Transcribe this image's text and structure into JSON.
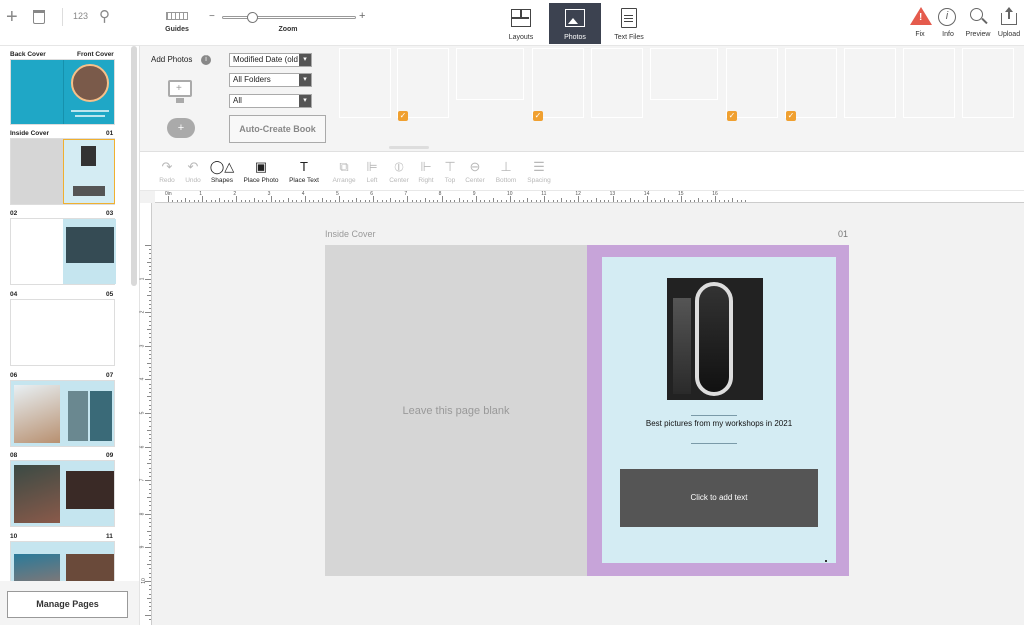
{
  "topbar": {
    "counter": "123",
    "guides_label": "Guides",
    "zoom_label": "Zoom",
    "zoom_minus": "−",
    "zoom_plus": "+",
    "zoom_level": 0.2,
    "tabs": [
      {
        "label": "Layouts",
        "icon": "layouts-icon"
      },
      {
        "label": "Photos",
        "icon": "photos-icon",
        "active": true
      },
      {
        "label": "Text Files",
        "icon": "text-files-icon"
      }
    ],
    "right": [
      {
        "label": "Fix",
        "icon": "warning-icon"
      },
      {
        "label": "Info",
        "icon": "info-icon"
      },
      {
        "label": "Preview",
        "icon": "search-icon"
      },
      {
        "label": "Upload",
        "icon": "upload-icon"
      }
    ]
  },
  "sidebar": {
    "back_cover": "Back Cover",
    "front_cover": "Front Cover",
    "inside_cover": "Inside Cover",
    "pages": [
      "01",
      "02",
      "03",
      "04",
      "05",
      "06",
      "07",
      "08",
      "09",
      "10",
      "11"
    ],
    "manage_pages": "Manage Pages"
  },
  "photos": {
    "add_photos": "Add Photos",
    "sort": "Modified Date (old",
    "folders": "All Folders",
    "filter": "All",
    "auto_create": "Auto-Create Book"
  },
  "toolbar": {
    "tools": [
      {
        "label": "Redo",
        "disabled": true
      },
      {
        "label": "Undo",
        "disabled": true
      },
      {
        "label": "Shapes",
        "disabled": false
      },
      {
        "label": "Place Photo",
        "disabled": false
      },
      {
        "label": "Place Text",
        "disabled": false
      },
      {
        "label": "Arrange",
        "disabled": true
      },
      {
        "label": "Left",
        "disabled": true
      },
      {
        "label": "Center",
        "disabled": true
      },
      {
        "label": "Right",
        "disabled": true
      },
      {
        "label": "Top",
        "disabled": true
      },
      {
        "label": "Center",
        "disabled": true
      },
      {
        "label": "Bottom",
        "disabled": true
      },
      {
        "label": "Spacing",
        "disabled": true
      }
    ]
  },
  "canvas": {
    "spread_left_label": "Inside Cover",
    "spread_right_label": "01",
    "blank_page_text": "Leave this page blank",
    "caption": "Best pictures from my workshops in 2021",
    "add_text": "Click to add text",
    "ruler_top": [
      "0in",
      "1",
      "2",
      "3",
      "4",
      "5",
      "6",
      "7",
      "8",
      "9",
      "10",
      "11",
      "12",
      "13",
      "14",
      "15",
      "16"
    ],
    "ruler_left": [
      "1",
      "2",
      "3",
      "4",
      "5",
      "6",
      "7",
      "8",
      "9",
      "10"
    ]
  },
  "colors": {
    "accent": "#3c4250",
    "page_bg": "#d4ecf3",
    "selection": "#c7a4d9",
    "blank_page": "#d6d6d6",
    "text_box": "#555555",
    "warning": "#e55b4d",
    "check": "#f0a030"
  }
}
